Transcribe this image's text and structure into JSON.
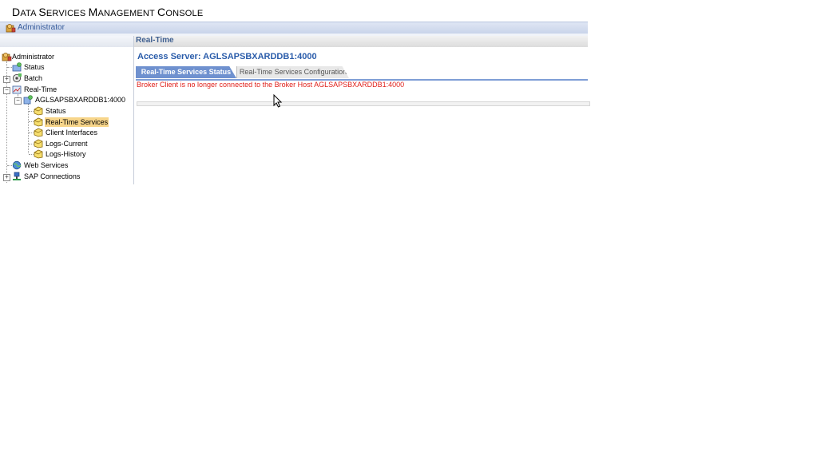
{
  "app": {
    "title_big_1": "D",
    "title_small_1": "ATA ",
    "title_big_2": "S",
    "title_small_2": "ERVICES ",
    "title_big_3": "M",
    "title_small_3": "ANAGEMENT ",
    "title_big_4": "C",
    "title_small_4": "ONSOLE"
  },
  "breadcrumb": {
    "label": "Administrator",
    "icon": "administrator-icon"
  },
  "main": {
    "section_title": "Real-Time",
    "access_server": "Access Server: AGLSAPSBXARDDB1:4000",
    "tabs": [
      {
        "label": "Real-Time Services Status",
        "active": true
      },
      {
        "label": "Real-Time Services Configuration",
        "active": false
      }
    ],
    "error_message": "Broker Client is no longer connected to the Broker Host AGLSAPSBXARDDB1:4000",
    "error_color": "#e0201a"
  },
  "tree": {
    "items": [
      {
        "label": "Administrator",
        "icon": "administrator-icon"
      },
      {
        "label": "Status",
        "icon": "status-icon"
      },
      {
        "label": "Batch",
        "icon": "batch-icon"
      },
      {
        "label": "Real-Time",
        "icon": "realtime-icon"
      },
      {
        "label": "AGLSAPSBXARDDB1:4000",
        "icon": "server-icon"
      },
      {
        "label": "Status",
        "icon": "folder-icon"
      },
      {
        "label": "Real-Time Services",
        "icon": "folder-icon",
        "selected": true
      },
      {
        "label": "Client Interfaces",
        "icon": "folder-icon"
      },
      {
        "label": "Logs-Current",
        "icon": "folder-icon"
      },
      {
        "label": "Logs-History",
        "icon": "folder-icon"
      },
      {
        "label": "Web Services",
        "icon": "web-services-icon"
      },
      {
        "label": "SAP Connections",
        "icon": "sap-connections-icon"
      }
    ]
  },
  "colors": {
    "accent": "#2a5caa",
    "tab_active": "#6f91cf",
    "selection": "#f7d58a"
  }
}
